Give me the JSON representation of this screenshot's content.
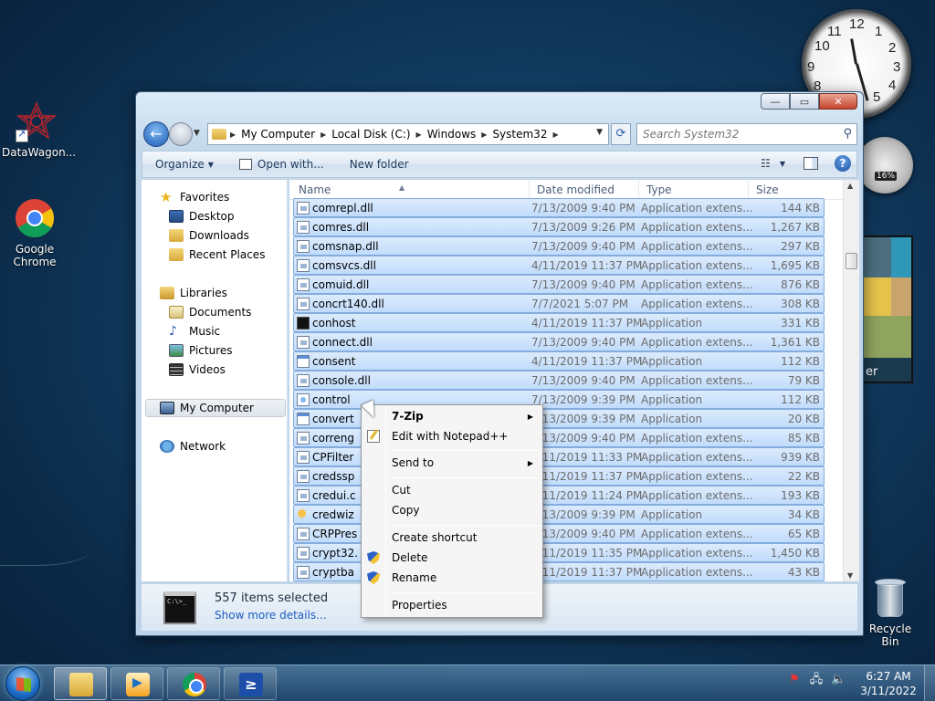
{
  "desktop": {
    "icons": [
      {
        "label": "DataWagon..."
      },
      {
        "label": "Google Chrome"
      }
    ],
    "recycle_bin": {
      "label": "Recycle Bin"
    },
    "gadgets": {
      "clock_numbers": [
        "12",
        "1",
        "2",
        "3",
        "4",
        "5",
        "7",
        "8",
        "9",
        "10",
        "11"
      ],
      "cpu_percent": "16%",
      "slideshow_text": "er"
    }
  },
  "window": {
    "controls": {
      "minimize": "—",
      "maximize": "▭",
      "close": "✕"
    },
    "address": {
      "crumbs": [
        "My Computer",
        "Local Disk (C:)",
        "Windows",
        "System32"
      ]
    },
    "search": {
      "placeholder": "Search System32"
    },
    "toolbar": {
      "organize": "Organize",
      "open_with": "Open with...",
      "new_folder": "New folder"
    },
    "nav": {
      "favorites": "Favorites",
      "desktop": "Desktop",
      "downloads": "Downloads",
      "recent_places": "Recent Places",
      "libraries": "Libraries",
      "documents": "Documents",
      "music": "Music",
      "pictures": "Pictures",
      "videos": "Videos",
      "my_computer": "My Computer",
      "network": "Network"
    },
    "columns": {
      "name": "Name",
      "date": "Date modified",
      "type": "Type",
      "size": "Size"
    },
    "files": [
      {
        "name": "comrepl.dll",
        "date": "7/13/2009 9:40 PM",
        "type": "Application extens...",
        "size": "144 KB",
        "icon": "dll"
      },
      {
        "name": "comres.dll",
        "date": "7/13/2009 9:26 PM",
        "type": "Application extens...",
        "size": "1,267 KB",
        "icon": "dll"
      },
      {
        "name": "comsnap.dll",
        "date": "7/13/2009 9:40 PM",
        "type": "Application extens...",
        "size": "297 KB",
        "icon": "dll"
      },
      {
        "name": "comsvcs.dll",
        "date": "4/11/2019 11:37 PM",
        "type": "Application extens...",
        "size": "1,695 KB",
        "icon": "dll"
      },
      {
        "name": "comuid.dll",
        "date": "7/13/2009 9:40 PM",
        "type": "Application extens...",
        "size": "876 KB",
        "icon": "dll"
      },
      {
        "name": "concrt140.dll",
        "date": "7/7/2021 5:07 PM",
        "type": "Application extens...",
        "size": "308 KB",
        "icon": "dll"
      },
      {
        "name": "conhost",
        "date": "4/11/2019 11:37 PM",
        "type": "Application",
        "size": "331 KB",
        "icon": "console"
      },
      {
        "name": "connect.dll",
        "date": "7/13/2009 9:40 PM",
        "type": "Application extens...",
        "size": "1,361 KB",
        "icon": "dll"
      },
      {
        "name": "consent",
        "date": "4/11/2019 11:37 PM",
        "type": "Application",
        "size": "112 KB",
        "icon": "exe"
      },
      {
        "name": "console.dll",
        "date": "7/13/2009 9:40 PM",
        "type": "Application extens...",
        "size": "79 KB",
        "icon": "dll"
      },
      {
        "name": "control",
        "date": "7/13/2009 9:39 PM",
        "type": "Application",
        "size": "112 KB",
        "icon": "control"
      },
      {
        "name": "convert",
        "date": "7/13/2009 9:39 PM",
        "type": "Application",
        "size": "20 KB",
        "icon": "exe"
      },
      {
        "name": "correng",
        "date": "7/13/2009 9:40 PM",
        "type": "Application extens...",
        "size": "85 KB",
        "icon": "dll"
      },
      {
        "name": "CPFilter",
        "date": "4/11/2019 11:33 PM",
        "type": "Application extens...",
        "size": "939 KB",
        "icon": "dll"
      },
      {
        "name": "credssp",
        "date": "4/11/2019 11:37 PM",
        "type": "Application extens...",
        "size": "22 KB",
        "icon": "dll"
      },
      {
        "name": "credui.c",
        "date": "4/11/2019 11:24 PM",
        "type": "Application extens...",
        "size": "193 KB",
        "icon": "dll"
      },
      {
        "name": "credwiz",
        "date": "7/13/2009 9:39 PM",
        "type": "Application",
        "size": "34 KB",
        "icon": "cred"
      },
      {
        "name": "CRPPres",
        "date": "7/13/2009 9:40 PM",
        "type": "Application extens...",
        "size": "65 KB",
        "icon": "dll"
      },
      {
        "name": "crypt32.",
        "date": "4/11/2019 11:35 PM",
        "type": "Application extens...",
        "size": "1,450 KB",
        "icon": "dll"
      },
      {
        "name": "cryptba",
        "date": "4/11/2019 11:37 PM",
        "type": "Application extens...",
        "size": "43 KB",
        "icon": "dll"
      }
    ],
    "details": {
      "title": "557 items selected",
      "link": "Show more details..."
    }
  },
  "context_menu": {
    "items": {
      "zip": "7-Zip",
      "notepad": "Edit with Notepad++",
      "send_to": "Send to",
      "cut": "Cut",
      "copy": "Copy",
      "create_shortcut": "Create shortcut",
      "delete": "Delete",
      "rename": "Rename",
      "properties": "Properties"
    }
  },
  "taskbar": {
    "time": "6:27 AM",
    "date": "3/11/2022",
    "powershell_glyph": "≥"
  }
}
